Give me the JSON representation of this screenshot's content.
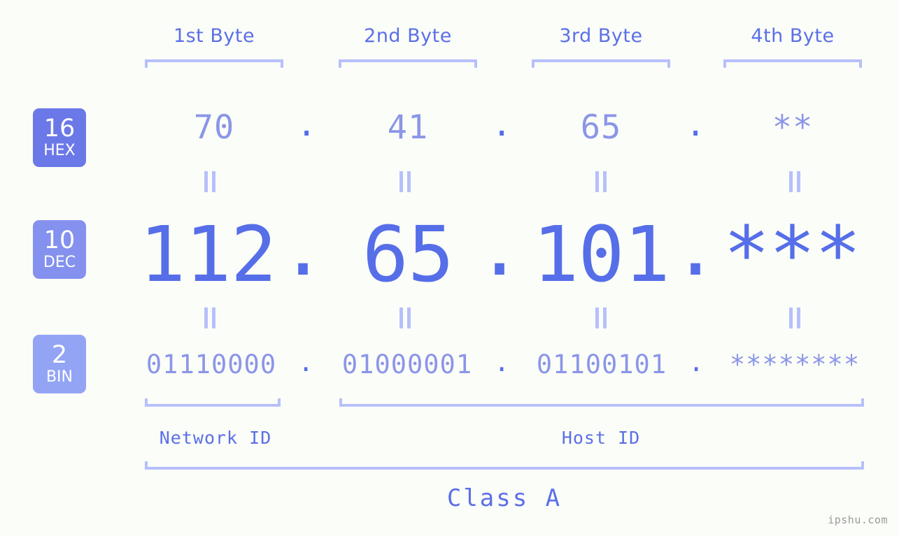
{
  "background_color": "#fbfdf8",
  "accent_dark": "#566ee8",
  "accent_mid": "#8b96e8",
  "accent_light": "#b7c0fb",
  "headers": [
    {
      "label": "1st Byte"
    },
    {
      "label": "2nd Byte"
    },
    {
      "label": "3rd Byte"
    },
    {
      "label": "4th Byte"
    }
  ],
  "bases": [
    {
      "num": "16",
      "abbr": "HEX",
      "color": "#6b78e8"
    },
    {
      "num": "10",
      "abbr": "DEC",
      "color": "#8491ee"
    },
    {
      "num": "2",
      "abbr": "BIN",
      "color": "#93a4f5"
    }
  ],
  "rows": {
    "hex": {
      "values": [
        "70",
        "41",
        "65",
        "**"
      ],
      "separator": "."
    },
    "dec": {
      "values": [
        "112",
        "65",
        "101",
        "***"
      ],
      "separator": "."
    },
    "bin": {
      "values": [
        "01110000",
        "01000001",
        "01100101",
        "********"
      ],
      "separator": "."
    }
  },
  "equals_symbol": "=",
  "captions": {
    "network_id": "Network ID",
    "host_id": "Host ID",
    "class": "Class A"
  },
  "watermark": "ipshu.com"
}
